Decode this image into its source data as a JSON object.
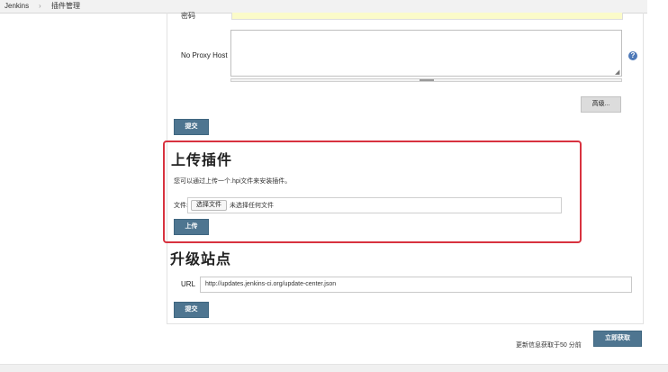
{
  "breadcrumb": {
    "items": [
      {
        "label": "Jenkins"
      },
      {
        "label": "插件管理"
      }
    ],
    "separator": "›"
  },
  "proxy": {
    "top_label": "密码",
    "no_proxy_label": "No Proxy Host",
    "no_proxy_value": "",
    "help_icon": "?",
    "advanced_button": "高级...",
    "submit_button": "提交"
  },
  "upload": {
    "title": "上传插件",
    "description": "您可以通过上传一个.hpi文件来安装插件。",
    "file_label": "文件:",
    "choose_file_button": "选择文件",
    "file_status": "未选择任何文件",
    "upload_button": "上传"
  },
  "update_site": {
    "title": "升级站点",
    "url_label": "URL",
    "url_value": "http://updates.jenkins-ci.org/update-center.json",
    "submit_button": "提交"
  },
  "footer": {
    "status_text": "更新信息获取于50 分前",
    "check_now_button": "立即获取"
  },
  "colors": {
    "accent_button": "#4e7590",
    "highlight_border": "#d8323f",
    "field_highlight": "#fbfbc9"
  }
}
